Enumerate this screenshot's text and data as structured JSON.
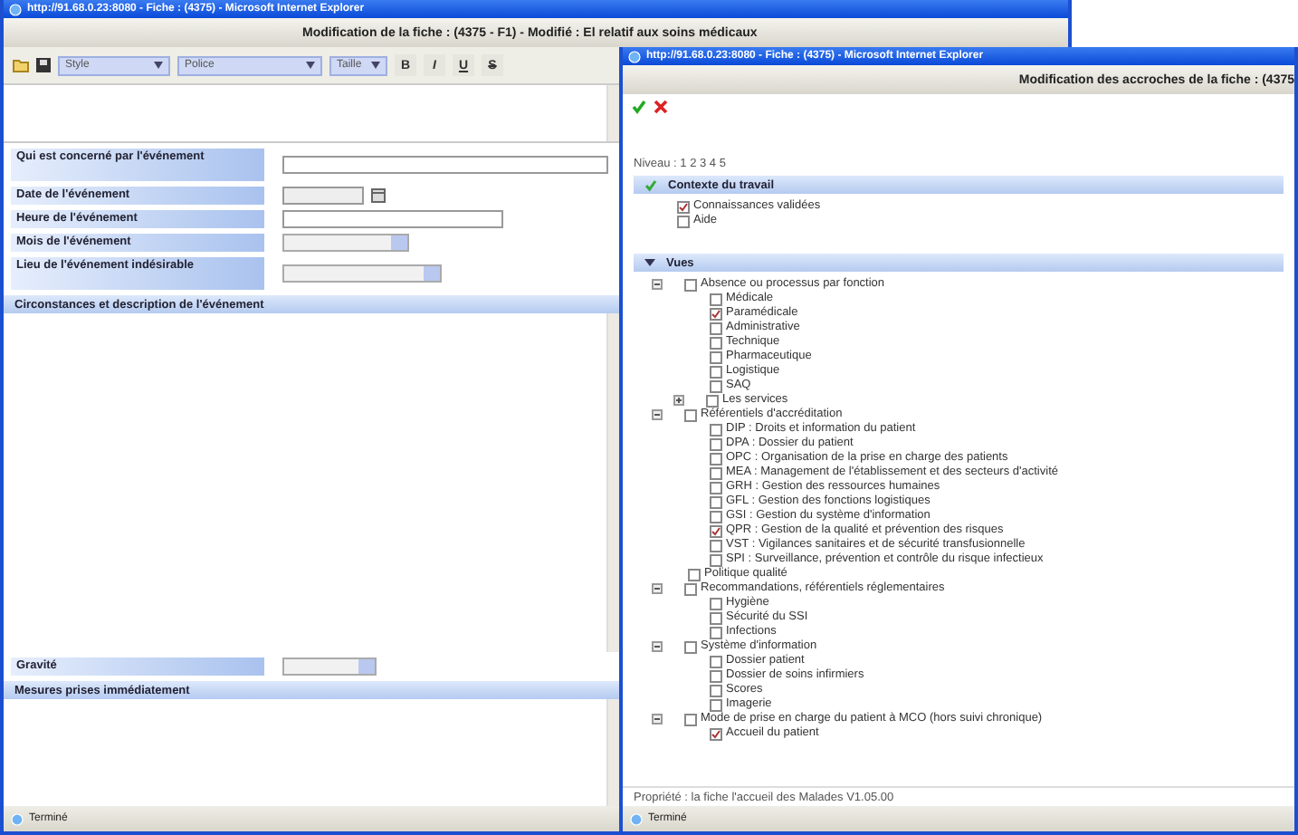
{
  "left_window": {
    "title": "http://91.68.0.23:8080 - Fiche : (4375) - Microsoft Internet Explorer",
    "header": "Modification de la fiche : (4375 - F1) - Modifié : El relatif aux soins médicaux",
    "toolbar": {
      "dropdowns": [
        "Style",
        "Police",
        "Taille"
      ],
      "format_buttons": [
        "B",
        "I",
        "U",
        "S"
      ]
    },
    "fields": [
      {
        "label": "Qui est concerné par l'événement",
        "kind": "text"
      },
      {
        "label": "Date de l'événement",
        "kind": "date"
      },
      {
        "label": "Heure de l'événement",
        "kind": "time"
      },
      {
        "label": "Mois de l'événement",
        "kind": "select"
      },
      {
        "label": "Lieu de l'événement indésirable",
        "kind": "select"
      }
    ],
    "description_section": "Circonstances et description de l'événement",
    "severity": {
      "label": "Gravité"
    },
    "measures_section": "Mesures prises immédiatement",
    "status": "Terminé"
  },
  "right_window": {
    "title": "http://91.68.0.23:8080 - Fiche : (4375) - Microsoft Internet Explorer",
    "header": "Modification des accroches de la fiche : (4375",
    "level_label": "Niveau : 1 2 3 4 5",
    "context": {
      "title": "Contexte du travail",
      "options": [
        {
          "label": "Connaissances validées",
          "checked": true
        },
        {
          "label": "Aide",
          "checked": false
        }
      ]
    },
    "views": {
      "title": "Vues",
      "items": [
        {
          "label": "Absence ou processus par fonction",
          "checked": false,
          "expanded": true,
          "children": [
            {
              "label": "Médicale",
              "checked": false
            },
            {
              "label": "Paramédicale",
              "checked": true
            },
            {
              "label": "Administrative",
              "checked": false
            },
            {
              "label": "Technique",
              "checked": false
            },
            {
              "label": "Pharmaceutique",
              "checked": false
            },
            {
              "label": "Logistique",
              "checked": false
            },
            {
              "label": "SAQ",
              "checked": false
            },
            {
              "label": "Les services",
              "checked": false,
              "expanded": false
            }
          ]
        },
        {
          "label": "Référentiels d'accréditation",
          "checked": false,
          "expanded": true,
          "children": [
            {
              "label": "DIP : Droits et information du patient",
              "checked": false
            },
            {
              "label": "DPA : Dossier du patient",
              "checked": false
            },
            {
              "label": "OPC : Organisation de la prise en charge des patients",
              "checked": false
            },
            {
              "label": "MEA : Management de l'établissement et des secteurs d'activité",
              "checked": false
            },
            {
              "label": "GRH : Gestion des ressources humaines",
              "checked": false
            },
            {
              "label": "GFL : Gestion des fonctions logistiques",
              "checked": false
            },
            {
              "label": "GSI : Gestion du système d'information",
              "checked": false
            },
            {
              "label": "QPR : Gestion de la qualité et prévention des risques",
              "checked": true
            },
            {
              "label": "VST : Vigilances sanitaires et de sécurité transfusionnelle",
              "checked": false
            },
            {
              "label": "SPI : Surveillance, prévention et contrôle du risque infectieux",
              "checked": false
            }
          ]
        },
        {
          "label": "Politique qualité",
          "checked": false
        },
        {
          "label": "Recommandations, référentiels réglementaires",
          "checked": false,
          "expanded": true,
          "children": [
            {
              "label": "Hygiène",
              "checked": false
            },
            {
              "label": "Sécurité du SSI",
              "checked": false
            },
            {
              "label": "Infections",
              "checked": false
            }
          ]
        },
        {
          "label": "Système d'information",
          "checked": false,
          "expanded": true,
          "children": [
            {
              "label": "Dossier patient",
              "checked": false
            },
            {
              "label": "Dossier de soins infirmiers",
              "checked": false
            },
            {
              "label": "Scores",
              "checked": false
            },
            {
              "label": "Imagerie",
              "checked": false
            }
          ]
        },
        {
          "label": "Mode de prise en charge du patient à MCO (hors suivi chronique)",
          "checked": false,
          "expanded": true,
          "children": [
            {
              "label": "Accueil du patient",
              "checked": true
            }
          ]
        }
      ]
    },
    "footer": "Propriété : la fiche l'accueil des Malades V1.05.00",
    "status": "Terminé"
  }
}
